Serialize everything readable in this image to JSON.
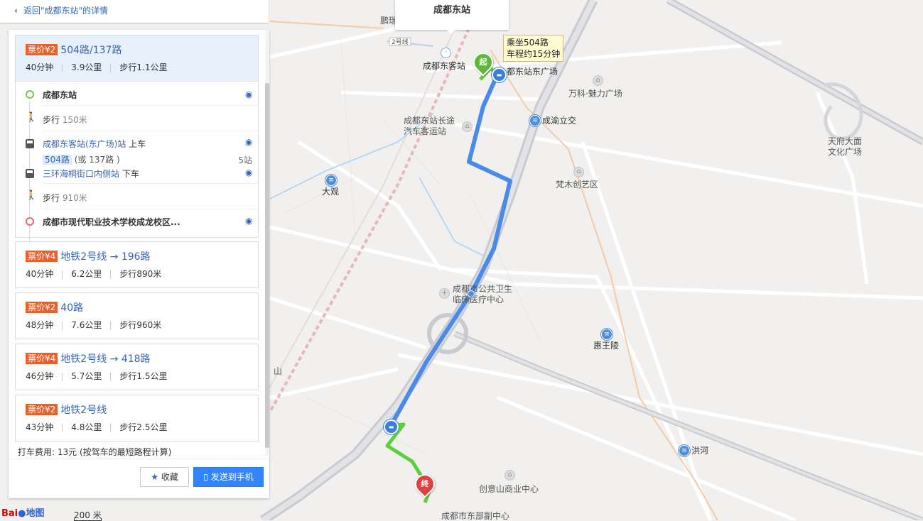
{
  "back": {
    "label": "返回\"成都东站\"的详情"
  },
  "top_card": {
    "title": "成都东站"
  },
  "map": {
    "labels": {
      "chengdudong_keyun": "成都东客站",
      "dongzhan_dongguangchang": "都东站东广场",
      "wanke": "万科·魅力广场",
      "changtu_1": "成都东站长途",
      "changtu_2": "汽车客运站",
      "chengyu": "成渝立交",
      "tianfu_1": "天府大面",
      "tianfu_2": "文化广场",
      "fanmu": "梵木创艺区",
      "daguan": "大观",
      "gonggong_1": "成都市公共卫生",
      "gonggong_2": "临床医疗中心",
      "huiwangling": "惠王陵",
      "honghe": "洪河",
      "chuangyishan": "创意山商业中心",
      "dongbu": "成都市东部副中心",
      "line2": "2号线",
      "pengrui": "鹏瑞",
      "shan": "山"
    },
    "start_pin": "起",
    "end_pin": "终",
    "tooltip_line1": "乘坐504路",
    "tooltip_line2": "车程约15分钟",
    "scale_text": "200 米",
    "logo_text": "Bai",
    "logo_text2": "地图"
  },
  "routes": [
    {
      "price": "票价¥2",
      "name": "504路/137路",
      "time": "40分钟",
      "distance": "3.9公里",
      "walk": "步行1.1公里",
      "steps": {
        "origin": "成都东站",
        "walk1": "步行",
        "walk1_dist": "150米",
        "board_stop": "成都东客站(东广场)站",
        "board_word": "上车",
        "bus_tag": "504路",
        "bus_alt": "(或 137路 )",
        "stops": "5站",
        "alight_stop": "三环海桐街口内侧站",
        "alight_word": "下车",
        "walk2": "步行",
        "walk2_dist": "910米",
        "destination": "成都市现代职业技术学校成龙校区..."
      }
    },
    {
      "price": "票价¥4",
      "name": "地铁2号线 → 196路",
      "time": "40分钟",
      "distance": "6.2公里",
      "walk": "步行890米"
    },
    {
      "price": "票价¥2",
      "name": "40路",
      "time": "48分钟",
      "distance": "7.6公里",
      "walk": "步行960米"
    },
    {
      "price": "票价¥4",
      "name": "地铁2号线 → 418路",
      "time": "46分钟",
      "distance": "5.7公里",
      "walk": "步行1.5公里"
    },
    {
      "price": "票价¥2",
      "name": "地铁2号线",
      "time": "43分钟",
      "distance": "4.8公里",
      "walk": "步行2.5公里"
    }
  ],
  "taxi": "打车费用: 13元  (按驾车的最短路程计算)",
  "buttons": {
    "favorite": "收藏",
    "send": "发送到手机"
  },
  "colors": {
    "accent": "#3385ff",
    "price": "#e8602c",
    "route_line": "#4a8ae8",
    "walk_line": "#5ccf3a"
  }
}
